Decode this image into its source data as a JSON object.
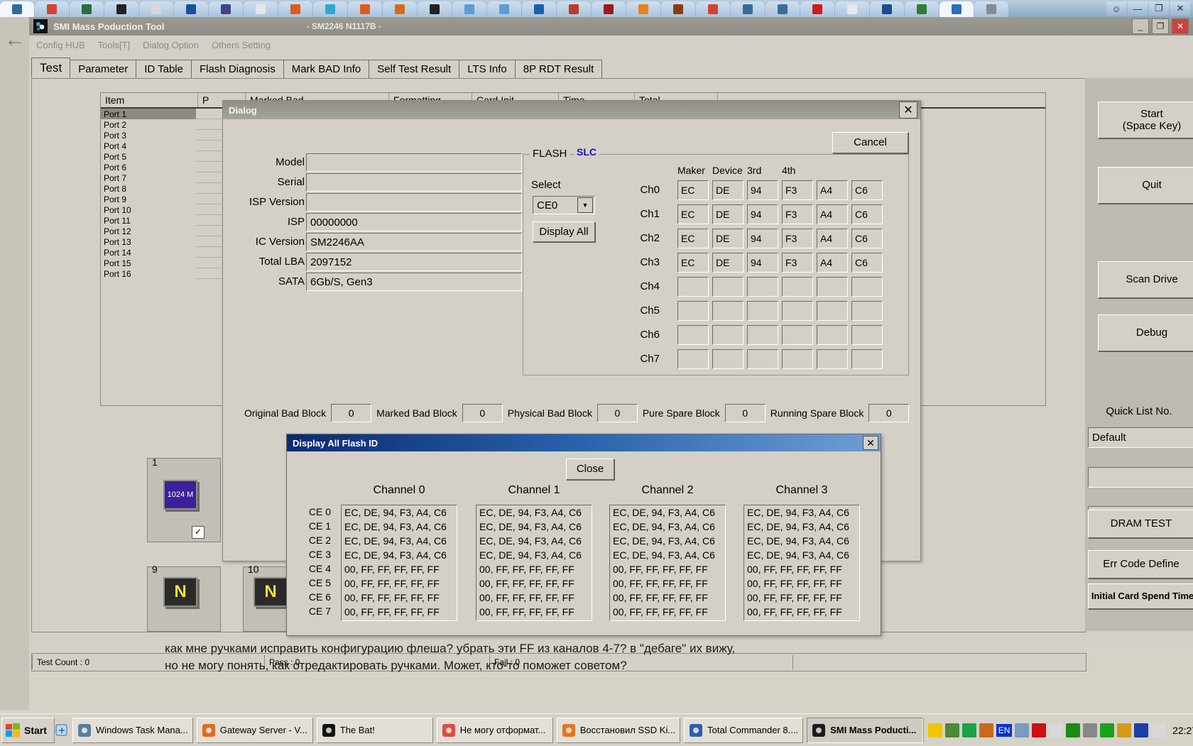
{
  "browser": {
    "tab_count": 29,
    "window_controls": [
      "person-icon",
      "minimize",
      "restore",
      "close"
    ]
  },
  "app": {
    "title": "SMI Mass Poduction Tool",
    "subtitle": "- SM2246 N1117B -",
    "icon": "smi-app-icon",
    "window_controls": {
      "minimize": "_",
      "restore": "❐",
      "close": "✕"
    },
    "menu": [
      "Config HUB",
      "Tools[T]",
      "Dialog Option",
      "Others Setting"
    ],
    "tabs": [
      {
        "label": "Test",
        "selected": true
      },
      {
        "label": "Parameter",
        "selected": false
      },
      {
        "label": "ID Table",
        "selected": false
      },
      {
        "label": "Flash Diagnosis",
        "selected": false
      },
      {
        "label": "Mark BAD Info",
        "selected": false
      },
      {
        "label": "Self Test Result",
        "selected": false
      },
      {
        "label": "LTS Info",
        "selected": false
      },
      {
        "label": "8P RDT Result",
        "selected": false
      }
    ],
    "port_table": {
      "columns": [
        "Item",
        "P",
        "Marked Bad",
        "Formatting",
        "Card Init",
        "Time",
        "Total"
      ],
      "rows": [
        "Port 1",
        "Port 2",
        "Port 3",
        "Port 4",
        "Port 5",
        "Port 6",
        "Port 7",
        "Port 8",
        "Port 9",
        "Port 10",
        "Port 11",
        "Port 12",
        "Port 13",
        "Port 14",
        "Port 15",
        "Port 16"
      ],
      "selected_row": "Port 1"
    },
    "drives": [
      {
        "num": "1",
        "label": "1024 M",
        "type": "chip",
        "checked": true
      },
      {
        "num": "9",
        "label": "N",
        "type": "n"
      },
      {
        "num": "10",
        "label": "N",
        "type": "n"
      }
    ],
    "right_panel": {
      "buttons": [
        {
          "label": "Start\n(Space Key)",
          "name": "start-button"
        },
        {
          "label": "Quit",
          "name": "quit-button"
        },
        {
          "label": "Scan Drive",
          "name": "scan-drive-button"
        },
        {
          "label": "Debug",
          "name": "debug-button"
        }
      ],
      "quick_list_label": "Quick List No.",
      "quick_list_value": "Default",
      "field2": "",
      "field3": "",
      "bottom_buttons": [
        "DRAM TEST",
        "Err Code Define",
        "Initial Card Spend Time"
      ]
    },
    "statusbar": {
      "test_count": "Test Count : 0",
      "pass": "Pass : 0",
      "fail": "Fail : 0",
      "extra": ""
    }
  },
  "dialog": {
    "title": "Dialog",
    "close_icon": "✕",
    "cancel_label": "Cancel",
    "fields": [
      {
        "label": "Model",
        "value": ""
      },
      {
        "label": "Serial",
        "value": ""
      },
      {
        "label": "ISP Version",
        "value": ""
      },
      {
        "label": "ISP",
        "value": "00000000"
      },
      {
        "label": "IC Version",
        "value": "SM2246AA"
      },
      {
        "label": "Total LBA",
        "value": "2097152"
      },
      {
        "label": "SATA",
        "value": "6Gb/S, Gen3"
      }
    ],
    "flash": {
      "legend": "FLASH",
      "slc_label": "SLC",
      "slc_color": "#1414c8",
      "select_label": "Select",
      "select_value": "CE0",
      "display_all_label": "Display All",
      "column_headers": [
        "Maker",
        "Device",
        "3rd",
        "4th"
      ],
      "channels": [
        {
          "label": "Ch0",
          "cells": [
            "EC",
            "DE",
            "94",
            "F3",
            "A4",
            "C6"
          ]
        },
        {
          "label": "Ch1",
          "cells": [
            "EC",
            "DE",
            "94",
            "F3",
            "A4",
            "C6"
          ]
        },
        {
          "label": "Ch2",
          "cells": [
            "EC",
            "DE",
            "94",
            "F3",
            "A4",
            "C6"
          ]
        },
        {
          "label": "Ch3",
          "cells": [
            "EC",
            "DE",
            "94",
            "F3",
            "A4",
            "C6"
          ]
        },
        {
          "label": "Ch4",
          "cells": [
            "",
            "",
            "",
            "",
            "",
            ""
          ]
        },
        {
          "label": "Ch5",
          "cells": [
            "",
            "",
            "",
            "",
            "",
            ""
          ]
        },
        {
          "label": "Ch6",
          "cells": [
            "",
            "",
            "",
            "",
            "",
            ""
          ]
        },
        {
          "label": "Ch7",
          "cells": [
            "",
            "",
            "",
            "",
            "",
            ""
          ]
        }
      ]
    },
    "blocks": [
      {
        "label": "Original Bad Block",
        "value": "0"
      },
      {
        "label": "Marked Bad Block",
        "value": "0"
      },
      {
        "label": "Physical Bad Block",
        "value": "0"
      },
      {
        "label": "Pure Spare Block",
        "value": "0"
      },
      {
        "label": "Running Spare Block",
        "value": "0"
      }
    ]
  },
  "flash_id_dialog": {
    "title": "Display All Flash ID",
    "close_icon": "✕",
    "close_label": "Close",
    "channel_headers": [
      "Channel 0",
      "Channel 1",
      "Channel 2",
      "Channel 3"
    ],
    "ce_labels": [
      "CE 0",
      "CE 1",
      "CE 2",
      "CE 3",
      "CE 4",
      "CE 5",
      "CE 6",
      "CE 7"
    ],
    "channels": [
      [
        "EC, DE, 94, F3, A4, C6",
        "EC, DE, 94, F3, A4, C6",
        "EC, DE, 94, F3, A4, C6",
        "EC, DE, 94, F3, A4, C6",
        "00, FF, FF, FF, FF, FF",
        "00, FF, FF, FF, FF, FF",
        "00, FF, FF, FF, FF, FF",
        "00, FF, FF, FF, FF, FF"
      ],
      [
        "EC, DE, 94, F3, A4, C6",
        "EC, DE, 94, F3, A4, C6",
        "EC, DE, 94, F3, A4, C6",
        "EC, DE, 94, F3, A4, C6",
        "00, FF, FF, FF, FF, FF",
        "00, FF, FF, FF, FF, FF",
        "00, FF, FF, FF, FF, FF",
        "00, FF, FF, FF, FF, FF"
      ],
      [
        "EC, DE, 94, F3, A4, C6",
        "EC, DE, 94, F3, A4, C6",
        "EC, DE, 94, F3, A4, C6",
        "EC, DE, 94, F3, A4, C6",
        "00, FF, FF, FF, FF, FF",
        "00, FF, FF, FF, FF, FF",
        "00, FF, FF, FF, FF, FF",
        "00, FF, FF, FF, FF, FF"
      ],
      [
        "EC, DE, 94, F3, A4, C6",
        "EC, DE, 94, F3, A4, C6",
        "EC, DE, 94, F3, A4, C6",
        "EC, DE, 94, F3, A4, C6",
        "00, FF, FF, FF, FF, FF",
        "00, FF, FF, FF, FF, FF",
        "00, FF, FF, FF, FF, FF",
        "00, FF, FF, FF, FF, FF"
      ]
    ]
  },
  "forum_text": {
    "line1": "как мне ручками исправить конфигурацию флеша? убрать эти FF из каналов 4-7? в \"дебаге\" их вижу,",
    "line2": "но не могу понять, как отредактировать ручками. Может, кто-то поможет советом?"
  },
  "taskbar": {
    "start_label": "Start",
    "quicklaunch": [
      "show-desktop-icon"
    ],
    "buttons": [
      {
        "label": "Windows Task Mana...",
        "icon": "taskmanager-icon",
        "color": "#5a7d9a",
        "active": false
      },
      {
        "label": "Gateway Server - V...",
        "icon": "gateway-icon",
        "color": "#e06a20",
        "active": false
      },
      {
        "label": "The Bat!",
        "icon": "thebat-icon",
        "color": "#111111",
        "active": false
      },
      {
        "label": "Не могу отформат...",
        "icon": "chrome-icon",
        "color": "#dd4b3e",
        "active": false
      },
      {
        "label": "Восстановил SSD Ki...",
        "icon": "firefox-icon",
        "color": "#e8751a",
        "active": false
      },
      {
        "label": "Total Commander 8....",
        "icon": "floppy-icon",
        "color": "#2d5fa8",
        "active": false
      },
      {
        "label": "SMI Mass Poducti...",
        "icon": "smi-app-icon",
        "color": "#1b1b1b",
        "active": true
      }
    ],
    "tray_icons": [
      "warning-icon",
      "network-icon",
      "utorrent-icon",
      "globe-icon",
      "language-icon",
      "user-icon",
      "antivirus-icon",
      "molecule-icon",
      "grid-icon",
      "wheel-icon",
      "pyramid-icon",
      "book-icon",
      "target-icon",
      "volume-icon"
    ],
    "language": "EN",
    "clock": "22:27"
  }
}
